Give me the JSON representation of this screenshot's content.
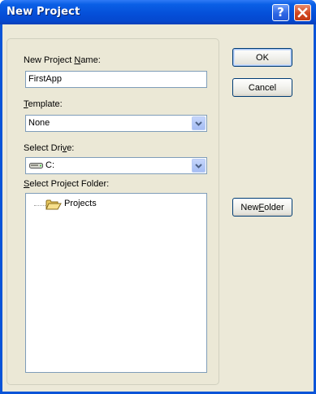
{
  "window": {
    "title": "New Project",
    "help_button": "?",
    "close_button": "×"
  },
  "form": {
    "name_label_pre": "New Project ",
    "name_label_key": "N",
    "name_label_post": "ame:",
    "name_value": "FirstApp",
    "template_label_key": "T",
    "template_label_post": "emplate:",
    "template_value": "None",
    "drive_label_pre": "Select Dri",
    "drive_label_key": "v",
    "drive_label_post": "e:",
    "drive_value": "C:",
    "folder_label_key": "S",
    "folder_label_post": "elect Project Folder:",
    "tree": [
      {
        "label": "Projects"
      }
    ]
  },
  "buttons": {
    "ok": "OK",
    "cancel": "Cancel",
    "new_folder_pre": "New ",
    "new_folder_key": "F",
    "new_folder_post": "older"
  },
  "icons": {
    "close": "close-icon",
    "help": "help-icon",
    "dropdown": "chevron-down-icon",
    "drive": "drive-icon",
    "folder": "folder-open-icon"
  }
}
